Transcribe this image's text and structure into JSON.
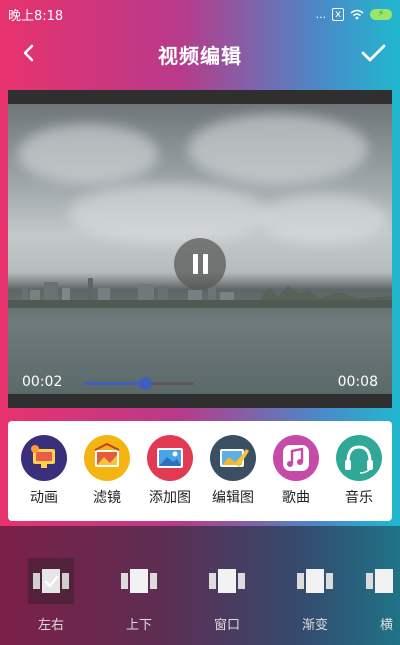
{
  "status": {
    "time": "晚上8:18",
    "signal": "...",
    "sim": "x",
    "battery": "⚡"
  },
  "header": {
    "title": "视频编辑"
  },
  "player": {
    "current_time": "00:02",
    "total_time": "00:08",
    "progress": 0.55
  },
  "tools": [
    {
      "label": "动画",
      "icon": "animation-icon",
      "color": "#3a2f7a"
    },
    {
      "label": "滤镜",
      "icon": "filter-icon",
      "color": "#f4b512"
    },
    {
      "label": "添加图",
      "icon": "add-image-icon",
      "color": "#e23a52"
    },
    {
      "label": "编辑图",
      "icon": "edit-image-icon",
      "color": "#3b4f63"
    },
    {
      "label": "歌曲",
      "icon": "song-icon",
      "color": "#c64aa8"
    },
    {
      "label": "音乐",
      "icon": "music-headphones-icon",
      "color": "#2fa898"
    }
  ],
  "transitions": [
    {
      "label": "左右",
      "icon": "left-right-transition-icon",
      "selected": true
    },
    {
      "label": "上下",
      "icon": "up-down-transition-icon",
      "selected": false
    },
    {
      "label": "窗口",
      "icon": "window-transition-icon",
      "selected": false
    },
    {
      "label": "渐变",
      "icon": "fade-transition-icon",
      "selected": false
    },
    {
      "label": "横",
      "icon": "horizontal-transition-icon",
      "selected": false
    }
  ]
}
